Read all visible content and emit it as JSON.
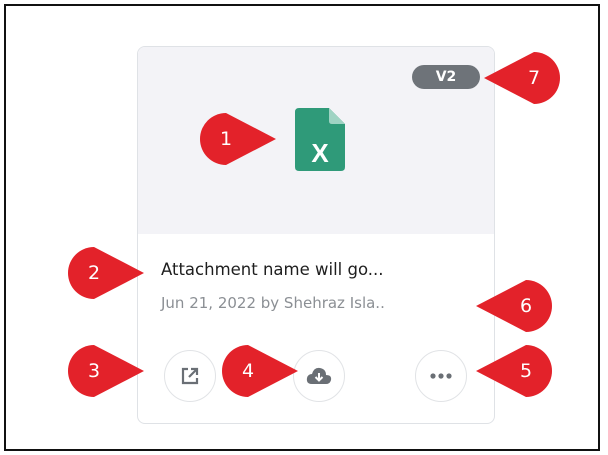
{
  "attachment": {
    "version": "V2",
    "file_type": "xlsx",
    "file_icon_glyph": "X",
    "title": "Attachment name will go...",
    "meta": "Jun 21, 2022 by Shehraz Isla..",
    "actions": [
      {
        "name": "open-in-new",
        "icon": "external-link-icon"
      },
      {
        "name": "download",
        "icon": "cloud-download-icon"
      },
      {
        "name": "more",
        "icon": "more-horizontal-icon"
      }
    ]
  },
  "callouts": [
    "1",
    "2",
    "3",
    "4",
    "5",
    "6",
    "7"
  ],
  "colors": {
    "preview_bg": "#f3f3f7",
    "excel_green": "#2f9a79",
    "badge_bg": "#6e7379",
    "callout_red": "#e3222a",
    "icon_gray": "#6a6f75"
  }
}
